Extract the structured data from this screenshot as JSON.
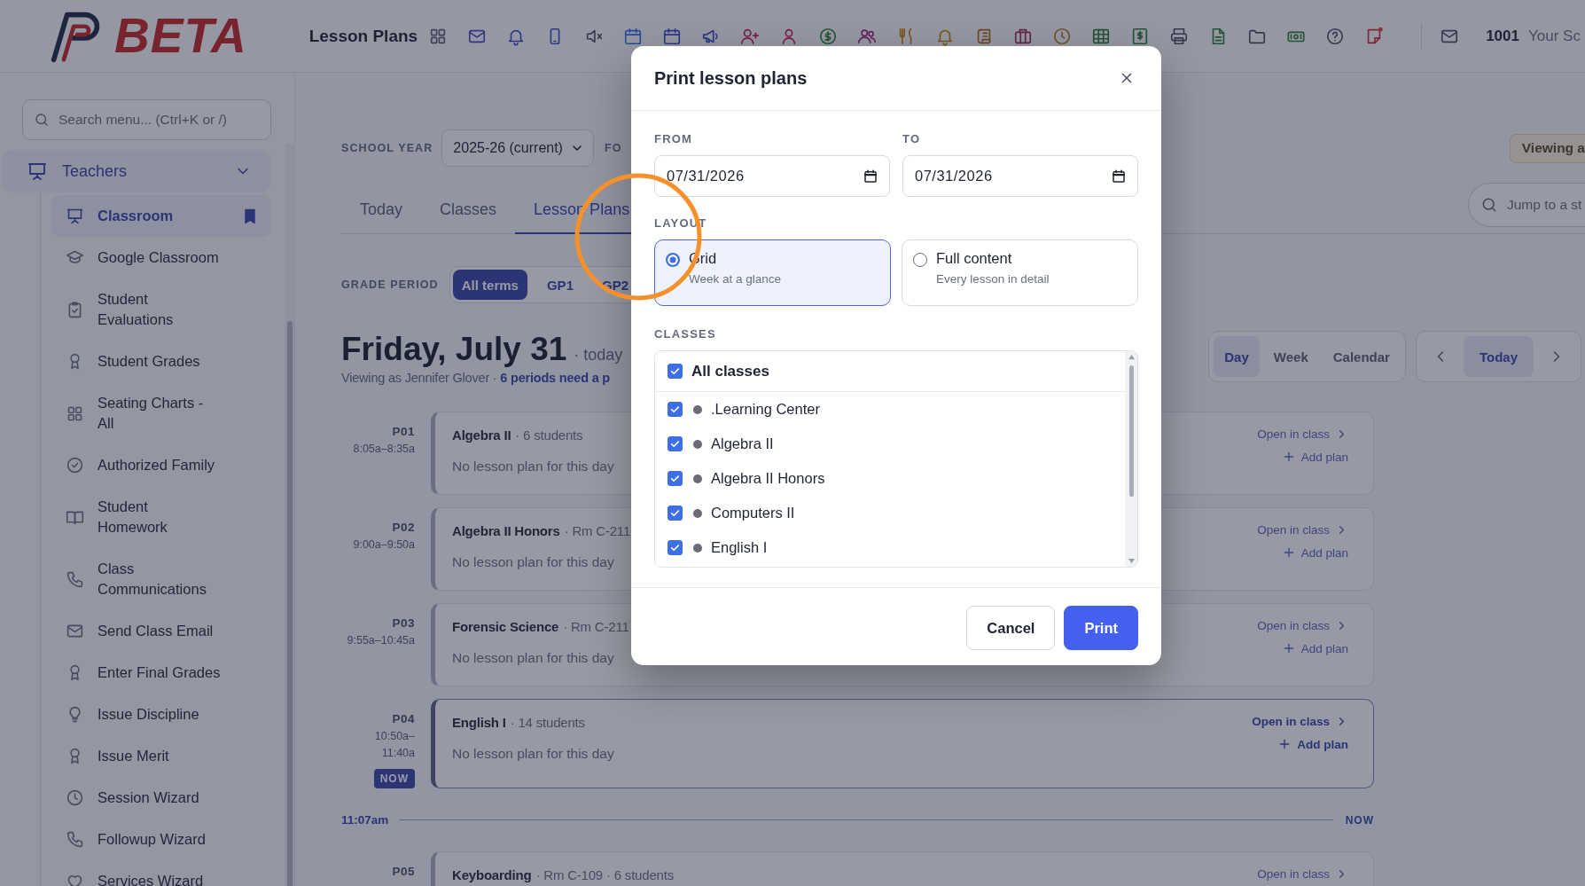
{
  "header": {
    "brand": "BETA",
    "page_title": "Lesson Plans",
    "user_id": "1001",
    "user_name": "Your Sc"
  },
  "sidebar": {
    "search_placeholder": "Search menu... (Ctrl+K or /)",
    "section": {
      "label": "Teachers",
      "expanded": true
    },
    "items": [
      {
        "label": "Classroom",
        "selected": true,
        "pinned": true
      },
      {
        "label": "Google Classroom",
        "selected": false,
        "pinned": false
      },
      {
        "label": "Student\nEvaluations",
        "selected": false,
        "pinned": false
      },
      {
        "label": "Student Grades",
        "selected": false,
        "pinned": false
      },
      {
        "label": "Seating Charts -\nAll",
        "selected": false,
        "pinned": false
      },
      {
        "label": "Authorized Family",
        "selected": false,
        "pinned": false
      },
      {
        "label": "Student\nHomework",
        "selected": false,
        "pinned": false
      },
      {
        "label": "Class\nCommunications",
        "selected": false,
        "pinned": false
      },
      {
        "label": "Send Class Email",
        "selected": false,
        "pinned": false
      },
      {
        "label": "Enter Final Grades",
        "selected": false,
        "pinned": false
      },
      {
        "label": "Issue Discipline",
        "selected": false,
        "pinned": false
      },
      {
        "label": "Issue Merit",
        "selected": false,
        "pinned": false
      },
      {
        "label": "Session Wizard",
        "selected": false,
        "pinned": false
      },
      {
        "label": "Followup Wizard",
        "selected": false,
        "pinned": false
      },
      {
        "label": "Services Wizard",
        "selected": false,
        "pinned": false
      }
    ]
  },
  "main": {
    "school_year_label": "SCHOOL YEAR",
    "school_year": "2025-26 (current)",
    "next_filter_label": "FO",
    "viewing_badge": "Viewing a",
    "jump_placeholder": "Jump to a st",
    "tabs": [
      {
        "label": "Today",
        "selected": false
      },
      {
        "label": "Classes",
        "selected": false
      },
      {
        "label": "Lesson Plans",
        "selected": true
      }
    ],
    "grade_period_label": "GRADE PERIOD",
    "grade_periods": [
      {
        "label": "All terms",
        "selected": true
      },
      {
        "label": "GP1",
        "selected": false
      },
      {
        "label": "GP2",
        "selected": false
      }
    ],
    "date_title": "Friday, July 31",
    "date_note": "· today",
    "viewing_as": "Viewing as Jennifer Glover · ",
    "needs_link": "6 periods need a p",
    "views": [
      {
        "label": "Day",
        "selected": true
      },
      {
        "label": "Week",
        "selected": false
      },
      {
        "label": "Calendar",
        "selected": false
      }
    ],
    "today_button": "Today",
    "periods": [
      {
        "period": "P01",
        "time": "8:05a–8:35a",
        "class": "Algebra II",
        "meta": "· 6 students",
        "plan": "No lesson plan for this day",
        "open": "Open in class",
        "add": "Add plan",
        "current": false
      },
      {
        "period": "P02",
        "time": "9:00a–9:50a",
        "class": "Algebra II Honors",
        "meta": "· Rm C-211",
        "plan": "No lesson plan for this day",
        "open": "Open in class",
        "add": "Add plan",
        "current": false
      },
      {
        "period": "P03",
        "time": "9:55a–10:45a",
        "class": "Forensic Science",
        "meta": "· Rm C-211",
        "plan": "No lesson plan for this day",
        "open": "Open in class",
        "add": "Add plan",
        "current": false
      },
      {
        "period": "P04",
        "time": "10:50a–\n11:40a",
        "badge": "NOW",
        "class": "English I",
        "meta": "· 14 students",
        "plan": "No lesson plan for this day",
        "open": "Open in class",
        "add": "Add plan",
        "current": true
      },
      {
        "period": "P05",
        "class": "Keyboarding",
        "meta": "· Rm C-109 · 6 students",
        "open": "Open in class",
        "current": false
      }
    ],
    "now_marker": {
      "time": "11:07am",
      "label": "NOW"
    }
  },
  "modal": {
    "title": "Print lesson plans",
    "from_label": "FROM",
    "from_date": "07/31/2026",
    "to_label": "TO",
    "to_date": "07/31/2026",
    "layout_label": "LAYOUT",
    "layouts": [
      {
        "title": "Grid",
        "subtitle": "Week at a glance",
        "selected": true
      },
      {
        "title": "Full content",
        "subtitle": "Every lesson in detail",
        "selected": false
      }
    ],
    "classes_label": "CLASSES",
    "all_classes": {
      "label": "All classes",
      "checked": true
    },
    "classes": [
      {
        "label": ".Learning Center",
        "checked": true
      },
      {
        "label": "Algebra II",
        "checked": true
      },
      {
        "label": "Algebra II Honors",
        "checked": true
      },
      {
        "label": "Computers II",
        "checked": true
      },
      {
        "label": "English I",
        "checked": true
      }
    ],
    "cancel": "Cancel",
    "print": "Print"
  }
}
